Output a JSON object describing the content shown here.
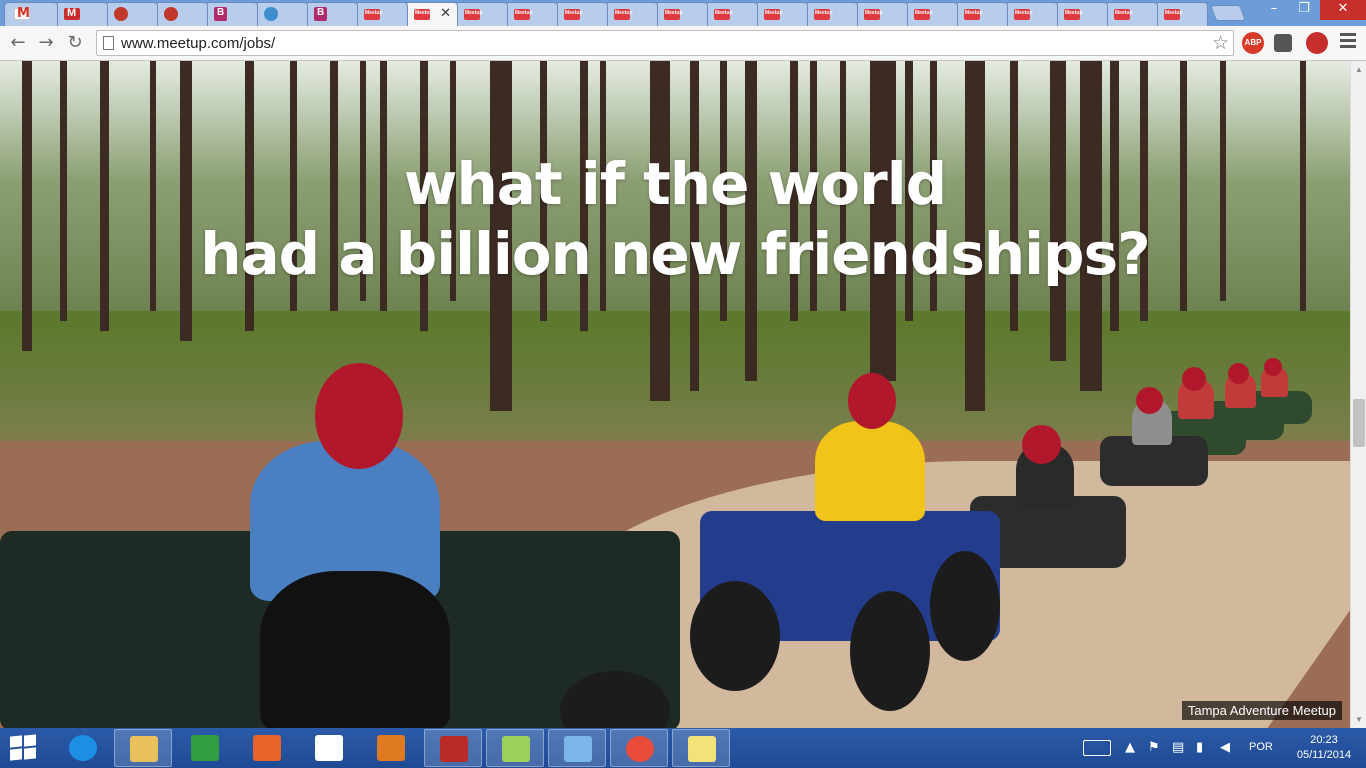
{
  "browser": {
    "tabs": [
      {
        "favicon": "gmail-icon",
        "active": false
      },
      {
        "favicon": "m-red-icon",
        "active": false
      },
      {
        "favicon": "red-circle-icon",
        "active": false
      },
      {
        "favicon": "red-circle-icon",
        "active": false
      },
      {
        "favicon": "b-pink-icon",
        "active": false
      },
      {
        "favicon": "globe-icon",
        "active": false
      },
      {
        "favicon": "b-pink-icon",
        "active": false
      },
      {
        "favicon": "meetup-icon",
        "active": false
      },
      {
        "favicon": "meetup-icon",
        "active": true
      },
      {
        "favicon": "meetup-icon",
        "active": false
      },
      {
        "favicon": "meetup-icon",
        "active": false
      },
      {
        "favicon": "meetup-icon",
        "active": false
      },
      {
        "favicon": "meetup-icon",
        "active": false
      },
      {
        "favicon": "meetup-icon",
        "active": false
      },
      {
        "favicon": "meetup-icon",
        "active": false
      },
      {
        "favicon": "meetup-icon",
        "active": false
      },
      {
        "favicon": "meetup-icon",
        "active": false
      },
      {
        "favicon": "meetup-icon",
        "active": false
      },
      {
        "favicon": "meetup-icon",
        "active": false
      },
      {
        "favicon": "meetup-icon",
        "active": false
      },
      {
        "favicon": "meetup-icon",
        "active": false
      },
      {
        "favicon": "meetup-icon",
        "active": false
      },
      {
        "favicon": "meetup-icon",
        "active": false
      },
      {
        "favicon": "meetup-icon",
        "active": false
      }
    ],
    "url": "www.meetup.com/jobs/",
    "extensions": {
      "abp_label": "ABP"
    }
  },
  "page": {
    "headline_line1": "what if the world",
    "headline_line2": "had a billion new friendships?",
    "photo_caption": "Tampa Adventure Meetup"
  },
  "taskbar": {
    "apps": [
      {
        "name": "internet-explorer",
        "open": false
      },
      {
        "name": "file-explorer",
        "open": true
      },
      {
        "name": "windows-store",
        "open": false
      },
      {
        "name": "app-orange",
        "open": false
      },
      {
        "name": "amazon",
        "open": false
      },
      {
        "name": "media-app",
        "open": false
      },
      {
        "name": "filezilla",
        "open": true
      },
      {
        "name": "notepad-plus",
        "open": true
      },
      {
        "name": "virtualbox",
        "open": true
      },
      {
        "name": "chrome",
        "open": true
      },
      {
        "name": "sticky-notes",
        "open": true
      }
    ],
    "language": "POR",
    "time": "20:23",
    "date": "05/11/2014"
  },
  "colors": {
    "tabstrip": "#6d9dd8",
    "taskbar": "#2b5aa8",
    "headline": "#ffffff"
  }
}
